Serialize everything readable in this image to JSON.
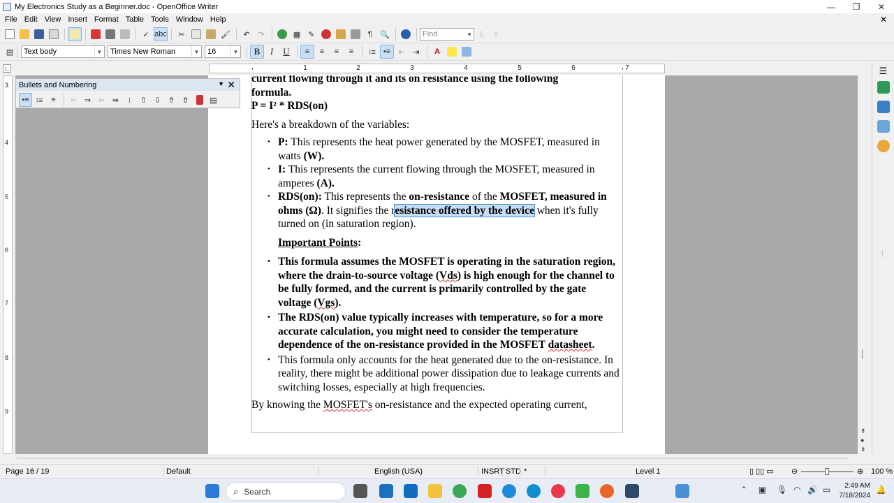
{
  "window": {
    "title": "My Electronics Study as a Beginner.doc - OpenOffice Writer",
    "controls": [
      "—",
      "❐",
      "✕"
    ]
  },
  "menu": [
    "File",
    "Edit",
    "View",
    "Insert",
    "Format",
    "Table",
    "Tools",
    "Window",
    "Help"
  ],
  "formatting": {
    "paragraph_style": "Text body",
    "font_name": "Times New Roman",
    "font_size": "16"
  },
  "find": {
    "placeholder": "Find"
  },
  "ruler": {
    "numbers": [
      "1",
      "2",
      "3",
      "4",
      "5",
      "6",
      "7"
    ],
    "vertical_numbers": [
      "3",
      "4",
      "5",
      "6",
      "7",
      "8",
      "9"
    ]
  },
  "bullets_panel": {
    "title": "Bullets and Numbering"
  },
  "document": {
    "intro_line1": "current flowing through it and its on resistance using the following",
    "intro_line2": "formula.",
    "formula": "P = I² * RDS(on)",
    "breakdown": "Here's a breakdown of the variables:",
    "var_p_term": "P:",
    "var_p_text": " This represents the heat power generated by the MOSFET, measured in watts ",
    "var_p_unit": "(W).",
    "var_i_term": "I:",
    "var_i_text": " This represents the current flowing through the MOSFET, measured in amperes ",
    "var_i_unit": "(A).",
    "var_r_term": "RDS(on):",
    "var_r_text1": " This represents the ",
    "var_r_bold1": "on-resistance",
    "var_r_text2": " of the ",
    "var_r_bold2": "MOSFET, measured in ohms (Ω)",
    "var_r_text3": ". It signifies the r",
    "var_r_selected": "esistance offered by the device",
    "var_r_text4": " when it's fully turned on (in saturation region).",
    "important_heading": "Important Points",
    "important_colon": ":",
    "point1_a": "This formula assumes the MOSFET is operating in the saturation region, where the drain-to-source voltage (",
    "point1_vds": "Vds",
    "point1_b": ") is high enough for the channel to be fully formed, and the current is primarily controlled by the gate voltage (",
    "point1_vgs": "Vgs",
    "point1_c": ").",
    "point2_a": "The RDS(on) value typically increases with temperature, so for a more accurate calculation, you might need to consider the temperature dependence of the on-resistance provided in the MOSFET ",
    "point2_ds": "datasheet",
    "point2_b": ".",
    "point3": "This formula only accounts for the heat generated due to the on-resistance. In reality, there might be additional power dissipation due to leakage currents and switching losses, especially at high frequencies.",
    "closing_a": "By knowing the ",
    "closing_mosfet": "MOSFET's",
    "closing_b": " on-resistance and the expected operating current,"
  },
  "status": {
    "page": "Page 16 / 19",
    "style": "Default",
    "language": "English (USA)",
    "insert_mode": "INSRT",
    "selection_mode": "STD",
    "modified": "*",
    "level": "Level 1",
    "zoom": "100 %"
  },
  "taskbar": {
    "search_label": "Search",
    "time": "2:49 AM",
    "date": "7/18/2024"
  },
  "colors": {
    "selection": "#c5def5",
    "workspace": "#a8a8a8",
    "accent": "#0067c0"
  }
}
